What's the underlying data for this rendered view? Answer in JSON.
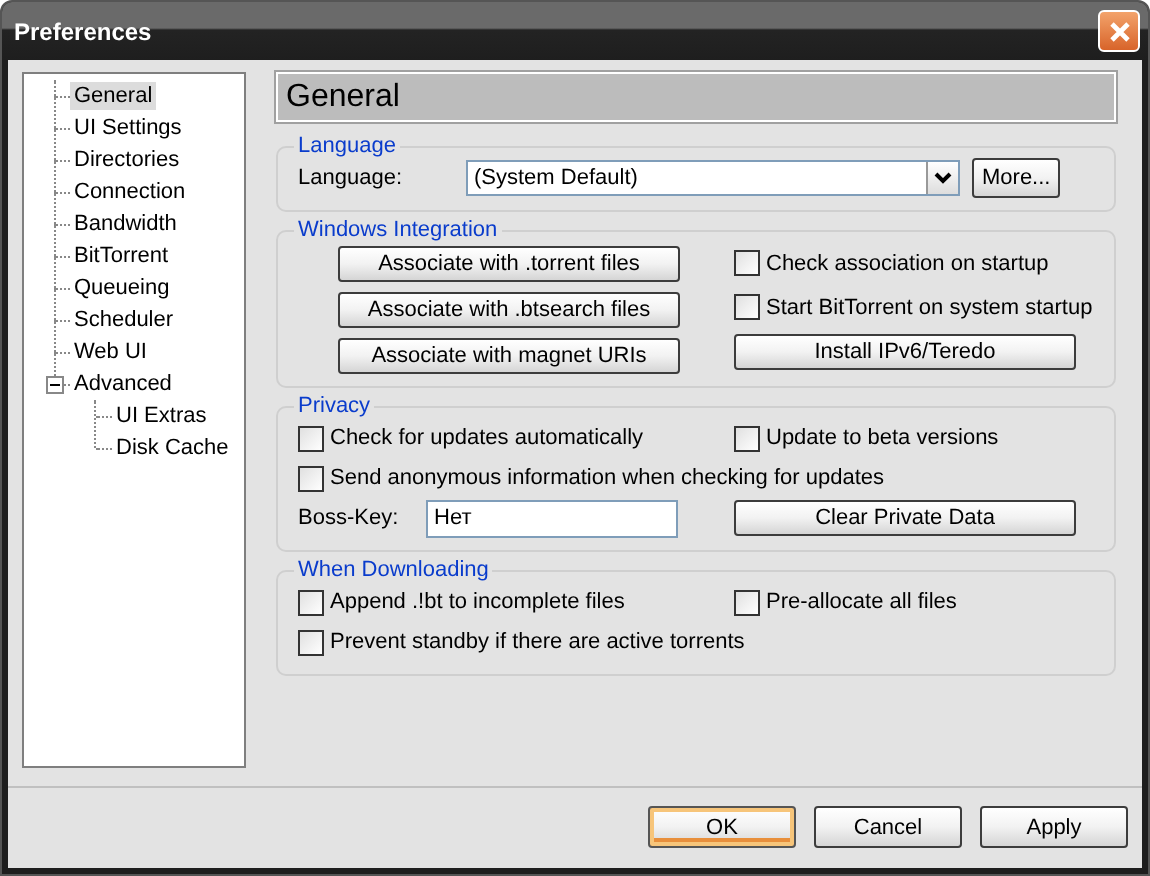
{
  "window": {
    "title": "Preferences"
  },
  "tree": [
    {
      "label": "General",
      "selected": true
    },
    {
      "label": "UI Settings",
      "selected": false
    },
    {
      "label": "Directories",
      "selected": false
    },
    {
      "label": "Connection",
      "selected": false
    },
    {
      "label": "Bandwidth",
      "selected": false
    },
    {
      "label": "BitTorrent",
      "selected": false
    },
    {
      "label": "Queueing",
      "selected": false
    },
    {
      "label": "Scheduler",
      "selected": false
    },
    {
      "label": "Web UI",
      "selected": false
    },
    {
      "label": "Advanced",
      "selected": false,
      "expanded": true,
      "children": [
        {
          "label": "UI Extras",
          "selected": false
        },
        {
          "label": "Disk Cache",
          "selected": false
        }
      ]
    }
  ],
  "heading": "General",
  "sections": [
    {
      "kind": "language",
      "title": "Language",
      "label": "Language:",
      "value": "(System Default)",
      "button": "More..."
    },
    {
      "kind": "integration",
      "title": "Windows Integration",
      "buttons": [
        "Associate with .torrent files",
        "Associate with .btsearch files",
        "Associate with magnet URIs"
      ],
      "checkboxes": [
        {
          "label": "Check association on startup",
          "checked": false
        },
        {
          "label": "Start BitTorrent on system startup",
          "checked": false
        }
      ],
      "extra_button": "Install IPv6/Teredo"
    },
    {
      "kind": "options",
      "title": "Privacy",
      "rows": [
        [
          {
            "kind": "checkbox",
            "label": "Check for updates automatically",
            "checked": false
          },
          {
            "kind": "checkbox",
            "label": "Update to beta versions",
            "checked": false
          }
        ],
        [
          {
            "kind": "checkbox",
            "label": "Send anonymous information when checking for updates",
            "checked": false
          }
        ],
        [
          {
            "kind": "field",
            "label": "Boss-Key:",
            "value": "Нет"
          },
          {
            "kind": "button",
            "label": "Clear Private Data"
          }
        ]
      ]
    },
    {
      "kind": "options",
      "title": "When Downloading",
      "rows": [
        [
          {
            "kind": "checkbox",
            "label": "Append .!bt to incomplete files",
            "checked": false
          },
          {
            "kind": "checkbox",
            "label": "Pre-allocate all files",
            "checked": false
          }
        ],
        [
          {
            "kind": "checkbox",
            "label": "Prevent standby if there are active torrents",
            "checked": false
          }
        ]
      ]
    }
  ],
  "buttons": [
    {
      "label": "OK",
      "default": true
    },
    {
      "label": "Cancel",
      "default": false
    },
    {
      "label": "Apply",
      "default": false
    }
  ]
}
